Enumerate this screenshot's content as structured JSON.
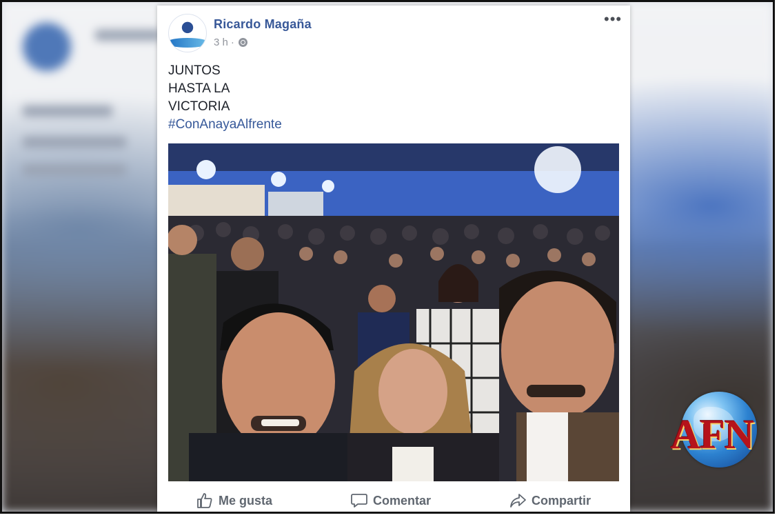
{
  "post": {
    "author": "Ricardo Magaña",
    "time": "3 h",
    "separator": "·",
    "privacy_icon": "globe-icon",
    "more_icon": "more-dots-icon",
    "more_label": "•••",
    "text_lines": [
      "JUNTOS",
      "HASTA LA",
      "VICTORIA"
    ],
    "hashtag": "#ConAnayaAlfrente"
  },
  "actions": {
    "like": {
      "label": "Me gusta",
      "icon": "thumbs-up-icon"
    },
    "comment": {
      "label": "Comentar",
      "icon": "comment-icon"
    },
    "share": {
      "label": "Compartir",
      "icon": "share-icon"
    }
  },
  "watermark": {
    "text": "AFN",
    "icon": "globe-logo"
  },
  "colors": {
    "author": "#385898",
    "hashtag": "#365899",
    "action_text": "#606770",
    "logo_red": "#b5131b"
  }
}
